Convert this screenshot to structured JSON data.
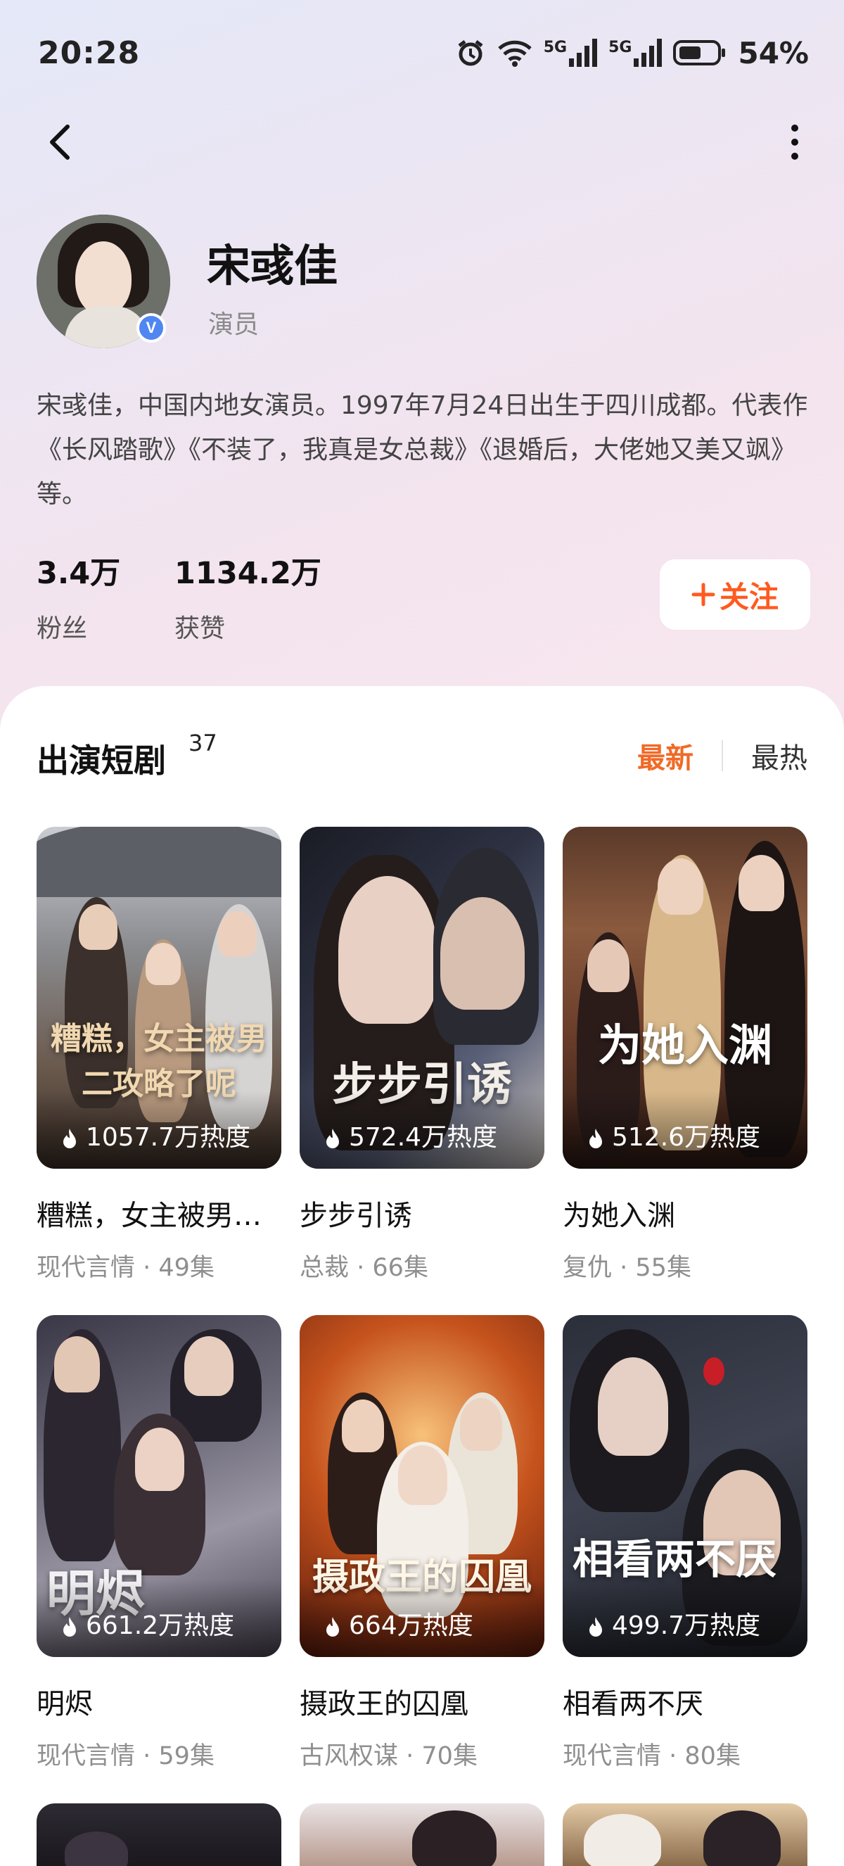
{
  "status_bar": {
    "time": "20:28",
    "network_1": "5G",
    "network_2": "5G",
    "battery": "54%",
    "icons": [
      "alarm-icon",
      "wifi-icon",
      "signal-icon",
      "signal-icon",
      "battery-icon"
    ]
  },
  "nav": {
    "back_icon": "chevron-left-icon",
    "more_icon": "more-vertical-icon"
  },
  "profile": {
    "name": "宋彧佳",
    "role": "演员",
    "verified_mark": "V",
    "bio": "宋彧佳，中国内地女演员。1997年7月24日出生于四川成都。代表作《长风踏歌》《不装了，我真是女总裁》《退婚后，大佬她又美又飒》等。",
    "stats": [
      {
        "value": "3.4万",
        "label": "粉丝"
      },
      {
        "value": "1134.2万",
        "label": "获赞"
      }
    ],
    "follow_label": "关注",
    "follow_icon": "plus-icon"
  },
  "colors": {
    "accent": "#f06a27",
    "follow_text": "#ff5a1f",
    "verified": "#4f86f2"
  },
  "dramas_section": {
    "title": "出演短剧",
    "count": "37",
    "tabs": [
      {
        "label": "最新",
        "active": true
      },
      {
        "label": "最热",
        "active": false
      }
    ],
    "items": [
      {
        "title": "糟糕，女主被男二攻略了呢",
        "poster_text": "糟糕，女主被男二攻略了呢",
        "heat": "1057.7万热度",
        "genre": "现代言情",
        "episodes": "49集"
      },
      {
        "title": "步步引诱",
        "poster_text": "步步引诱",
        "heat": "572.4万热度",
        "genre": "总裁",
        "episodes": "66集"
      },
      {
        "title": "为她入渊",
        "poster_text": "为她入渊",
        "heat": "512.6万热度",
        "genre": "复仇",
        "episodes": "55集"
      },
      {
        "title": "明烬",
        "poster_text": "明烬",
        "heat": "661.2万热度",
        "genre": "现代言情",
        "episodes": "59集"
      },
      {
        "title": "摄政王的囚凰",
        "poster_text": "摄政王的囚凰",
        "heat": "664万热度",
        "genre": "古风权谋",
        "episodes": "70集"
      },
      {
        "title": "相看两不厌",
        "poster_text": "相看两不厌",
        "heat": "499.7万热度",
        "genre": "现代言情",
        "episodes": "80集"
      }
    ]
  }
}
